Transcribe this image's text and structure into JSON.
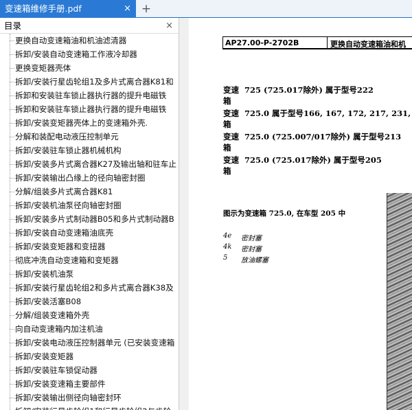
{
  "tab": {
    "title": "变速箱维修手册.pdf",
    "close": "×",
    "new_tab": "+"
  },
  "outline_panel": {
    "title": "目录",
    "close": "×",
    "items": [
      "更换自动变速箱油和机油滤清器",
      "拆卸/安装自动变速箱工作液冷却器",
      "更换变矩器壳体",
      "拆卸/安装行星齿轮组1及多片式离合器K81和",
      "拆卸和安装驻车锁止器执行器的提升电磁铁",
      "拆卸和安装驻车锁止器执行器的提升电磁铁",
      "拆卸/安装变矩器壳体上的变速箱外壳.",
      "分解和装配电动液压控制单元",
      "拆卸/安装驻车锁止器机械机构",
      "拆卸/安装多片式离合器K27及输出轴和驻车止",
      "拆卸/安装输出凸缘上的径向轴密封圈",
      "分解/组装多片式离合器K81",
      "拆卸/安装机油泵径向轴密封圈",
      "拆卸/安装多片式制动器B05和多片式制动器B",
      "拆卸/安装自动变速箱油底壳",
      "拆卸/安装变矩器和变扭器",
      "彻底冲洗自动变速箱和变矩器",
      "拆卸/安装机油泵",
      "拆卸/安装行星齿轮组2和多片式离合器K38及",
      "拆卸/安装活塞B08",
      "分解/组装变速箱外壳",
      "向自动变速箱内加注机油",
      "拆卸/安装电动液压控制器单元 (已安装变速箱",
      "拆卸/安装变矩器",
      "拆卸/安装驻车锁促动器",
      "拆卸/安装变速箱主要部件",
      "拆卸/安装输出侧径向轴密封环",
      "拆卸/安装行星齿轮组1和行星齿轮组2与齿轮"
    ]
  },
  "document": {
    "header_code": "AP27.00-P-2702B",
    "header_title": "更换自动变速箱油和机",
    "transmissions": [
      {
        "w1": "变速",
        "w2": "箱",
        "rest": "725  (725.017除外)  属于型号222"
      },
      {
        "w1": "变速",
        "w2": "箱",
        "rest": "725.0 属于型号166, 167, 172, 217, 231, 238, 2"
      },
      {
        "w1": "变速",
        "w2": "箱",
        "rest": "725.0  (725.007/017除外)  属于型号213"
      },
      {
        "w1": "变速",
        "w2": "箱",
        "rest": "725.0  (725.017除外)  属于型号205"
      }
    ],
    "caption": "图示为变速箱 725.0, 在车型 205 中",
    "legend": [
      {
        "key": "4e",
        "value": "密封塞"
      },
      {
        "key": "4k",
        "value": "密封塞"
      },
      {
        "key": "5",
        "value": "放油螺塞"
      }
    ]
  }
}
